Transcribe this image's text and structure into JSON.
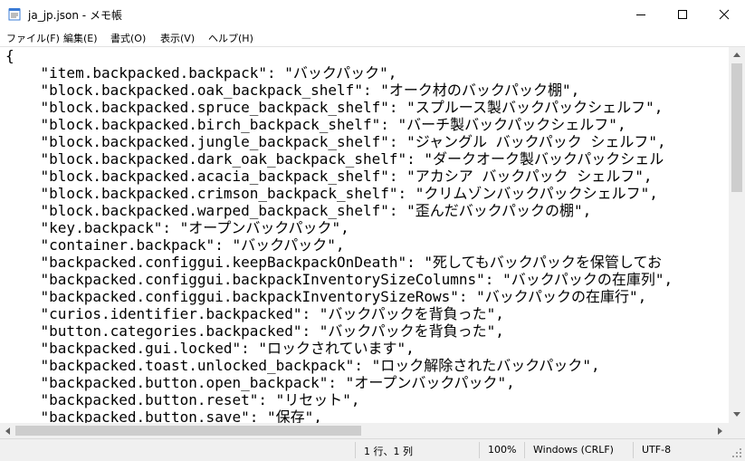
{
  "window": {
    "title": "ja_jp.json - メモ帳",
    "minimize_icon": "minimize-icon",
    "maximize_icon": "maximize-icon",
    "close_icon": "close-icon",
    "app_icon": "notepad-icon"
  },
  "menu": {
    "items": [
      "ファイル(F)",
      "編集(E)",
      "書式(O)",
      "表示(V)",
      "ヘルプ(H)"
    ]
  },
  "editor": {
    "lines": [
      "{",
      "    \"item.backpacked.backpack\": \"バックパック\",",
      "    \"block.backpacked.oak_backpack_shelf\": \"オーク材のバックパック棚\",",
      "    \"block.backpacked.spruce_backpack_shelf\": \"スプルース製バックパックシェルフ\",",
      "    \"block.backpacked.birch_backpack_shelf\": \"バーチ製バックパックシェルフ\",",
      "    \"block.backpacked.jungle_backpack_shelf\": \"ジャングル バックパック シェルフ\",",
      "    \"block.backpacked.dark_oak_backpack_shelf\": \"ダークオーク製バックパックシェル",
      "    \"block.backpacked.acacia_backpack_shelf\": \"アカシア バックパック シェルフ\",",
      "    \"block.backpacked.crimson_backpack_shelf\": \"クリムゾンバックパックシェルフ\",",
      "    \"block.backpacked.warped_backpack_shelf\": \"歪んだバックパックの棚\",",
      "    \"key.backpack\": \"オープンバックパック\",",
      "    \"container.backpack\": \"バックパック\",",
      "    \"backpacked.configgui.keepBackpackOnDeath\": \"死してもバックパックを保管してお",
      "    \"backpacked.configgui.backpackInventorySizeColumns\": \"バックパックの在庫列\",",
      "    \"backpacked.configgui.backpackInventorySizeRows\": \"バックパックの在庫行\",",
      "    \"curios.identifier.backpacked\": \"バックパックを背負った\",",
      "    \"button.categories.backpacked\": \"バックパックを背負った\",",
      "    \"backpacked.gui.locked\": \"ロックされています\",",
      "    \"backpacked.toast.unlocked_backpack\": \"ロック解除されたバックパック\",",
      "    \"backpacked.button.open_backpack\": \"オープンバックパック\",",
      "    \"backpacked.button.reset\": \"リセット\",",
      "    \"backpacked.button.save\": \"保存\","
    ]
  },
  "status": {
    "position": "1 行、1 列",
    "zoom": "100%",
    "line_ending": "Windows (CRLF)",
    "encoding": "UTF-8"
  }
}
